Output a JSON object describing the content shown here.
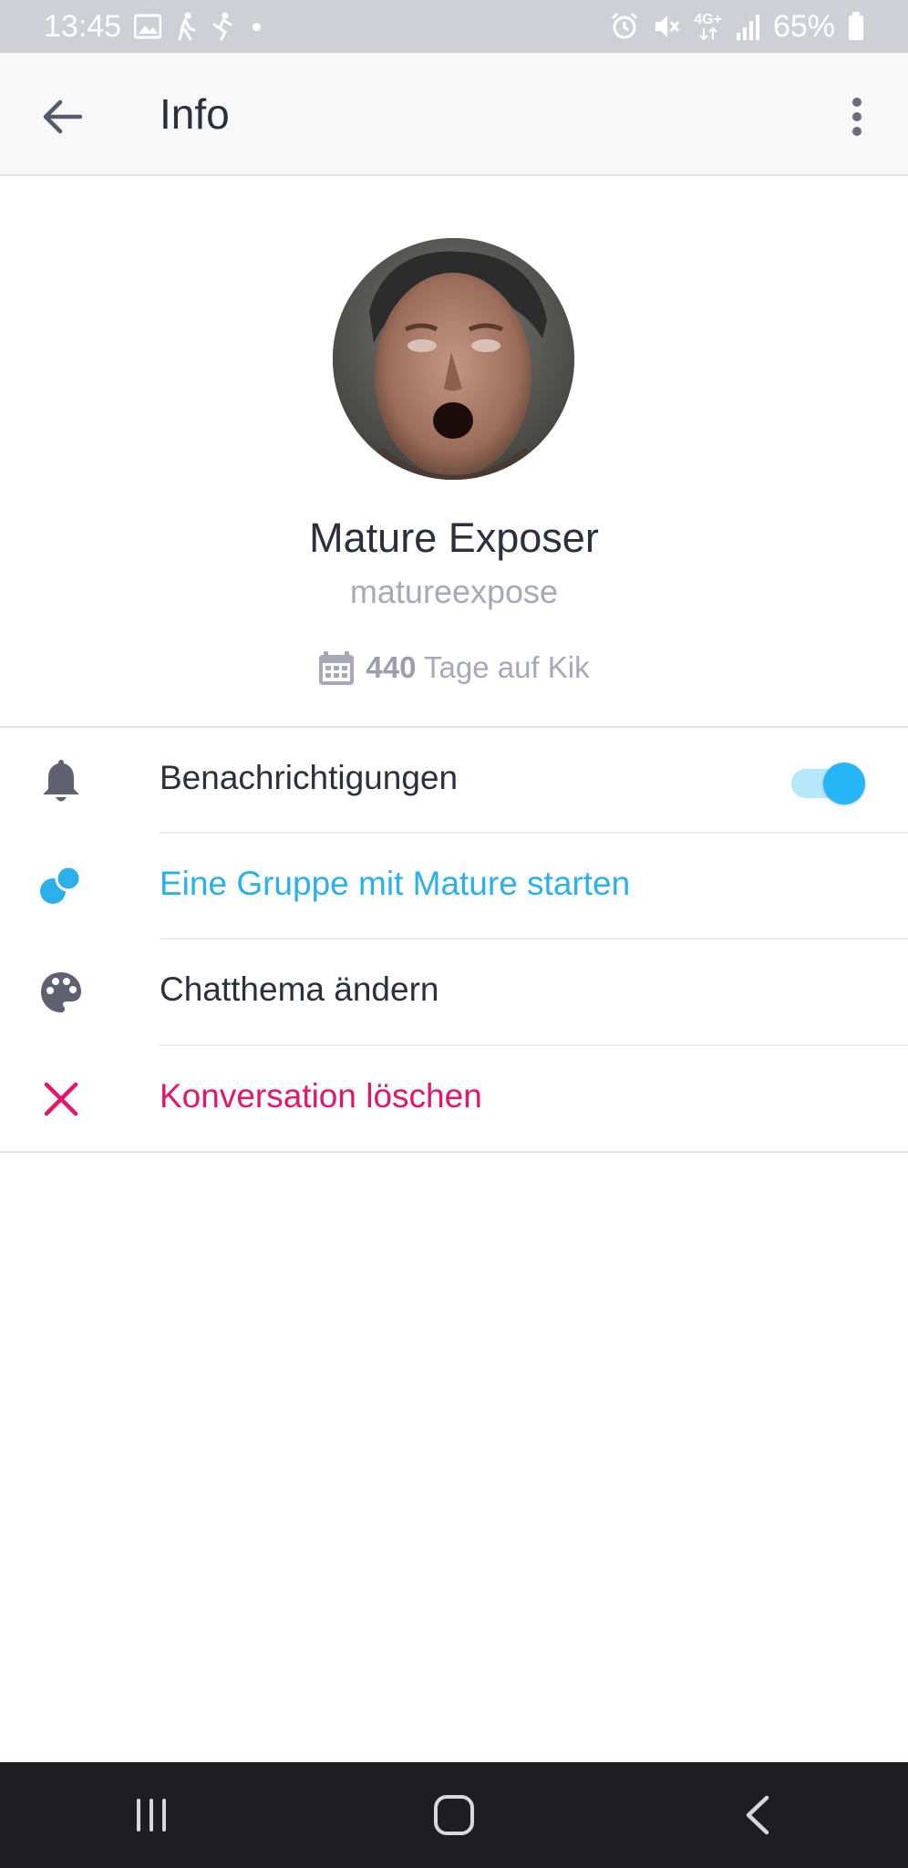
{
  "status_bar": {
    "time": "13:45",
    "battery": "65%",
    "network": "4G+",
    "icons_left": [
      "image-icon",
      "walk-icon",
      "fitness-icon",
      "dot-icon"
    ],
    "icons_right": [
      "alarm-icon",
      "mute-icon",
      "network-icon",
      "signal-icon",
      "battery-icon"
    ]
  },
  "app_bar": {
    "title": "Info",
    "back_icon": "arrow-left-icon",
    "menu_icon": "more-vert-icon"
  },
  "profile": {
    "display_name": "Mature Exposer",
    "username": "matureexpose",
    "days_count": "440",
    "days_label": "Tage auf Kik",
    "avatar": "profile-photo"
  },
  "menu": {
    "notifications": {
      "label": "Benachrichtigungen",
      "icon": "bell-icon",
      "enabled": true
    },
    "start_group": {
      "label": "Eine Gruppe mit Mature starten",
      "icon": "group-icon"
    },
    "chat_theme": {
      "label": "Chatthema ändern",
      "icon": "palette-icon"
    },
    "delete_conversation": {
      "label": "Konversation löschen",
      "icon": "close-icon"
    }
  },
  "colors": {
    "accent_blue": "#2bb0ea",
    "delete_red": "#e0176a",
    "text_dark": "#2e2f3e",
    "text_muted": "#a7a8b8"
  },
  "nav_bar": {
    "buttons": [
      "recent-apps-icon",
      "home-icon",
      "back-icon"
    ]
  }
}
